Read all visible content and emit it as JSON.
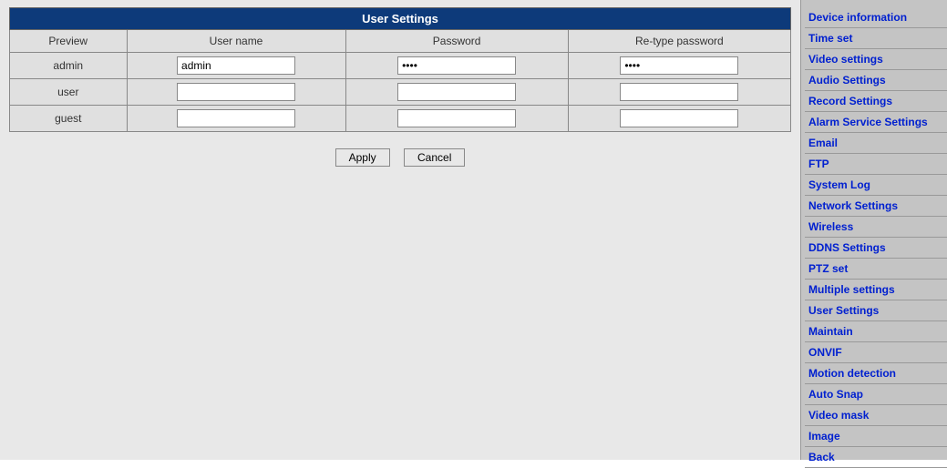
{
  "title": "User Settings",
  "columns": {
    "preview": "Preview",
    "username": "User name",
    "password": "Password",
    "retype": "Re-type password"
  },
  "rows": [
    {
      "preview": "admin",
      "username": "admin",
      "password": "••••",
      "retype": "••••"
    },
    {
      "preview": "user",
      "username": "",
      "password": "",
      "retype": ""
    },
    {
      "preview": "guest",
      "username": "",
      "password": "",
      "retype": ""
    }
  ],
  "buttons": {
    "apply": "Apply",
    "cancel": "Cancel"
  },
  "sidebar": {
    "items": [
      "Device information",
      "Time set",
      "Video settings",
      "Audio Settings",
      "Record Settings",
      "Alarm Service Settings",
      "Email",
      "FTP",
      "System Log",
      "Network Settings",
      "Wireless",
      "DDNS Settings",
      "PTZ set",
      "Multiple settings",
      "User Settings",
      "Maintain",
      "ONVIF",
      "Motion detection",
      "Auto Snap",
      "Video mask",
      "Image",
      "Back"
    ]
  }
}
